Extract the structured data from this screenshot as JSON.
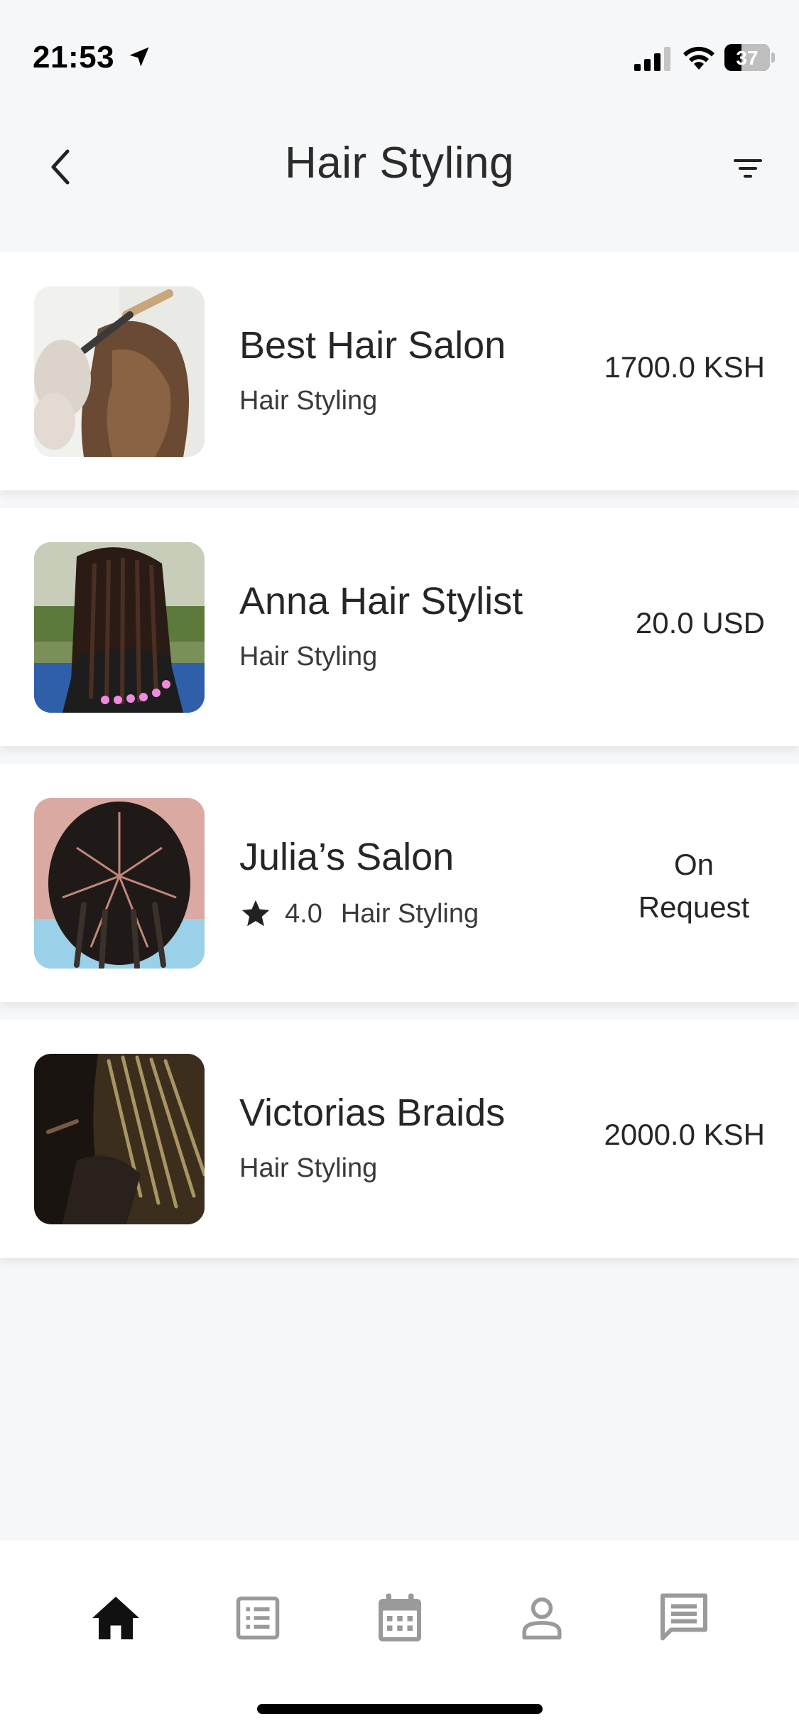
{
  "status_bar": {
    "time": "21:53",
    "battery": "37",
    "icons": [
      "location-arrow-icon",
      "cellular-signal-icon",
      "wifi-icon",
      "battery-icon"
    ]
  },
  "header": {
    "title": "Hair Styling",
    "back_icon": "chevron-left-icon",
    "filter_icon": "filter-icon"
  },
  "listings": [
    {
      "name": "Best Hair Salon",
      "category": "Hair Styling",
      "price": "1700.0 KSH",
      "rating": null
    },
    {
      "name": "Anna Hair Stylist",
      "category": "Hair Styling",
      "price": "20.0 USD",
      "rating": null
    },
    {
      "name": "Julia’s Salon",
      "category": "Hair Styling",
      "price": "On Request",
      "rating": "4.0"
    },
    {
      "name": "Victorias Braids",
      "category": "Hair Styling",
      "price": "2000.0 KSH",
      "rating": null
    }
  ],
  "bottom_nav": {
    "items": [
      "home-icon",
      "list-icon",
      "calendar-icon",
      "profile-icon",
      "messages-icon"
    ],
    "active": "home-icon",
    "active_color": "#111111",
    "inactive_color": "#9a9a9a"
  }
}
